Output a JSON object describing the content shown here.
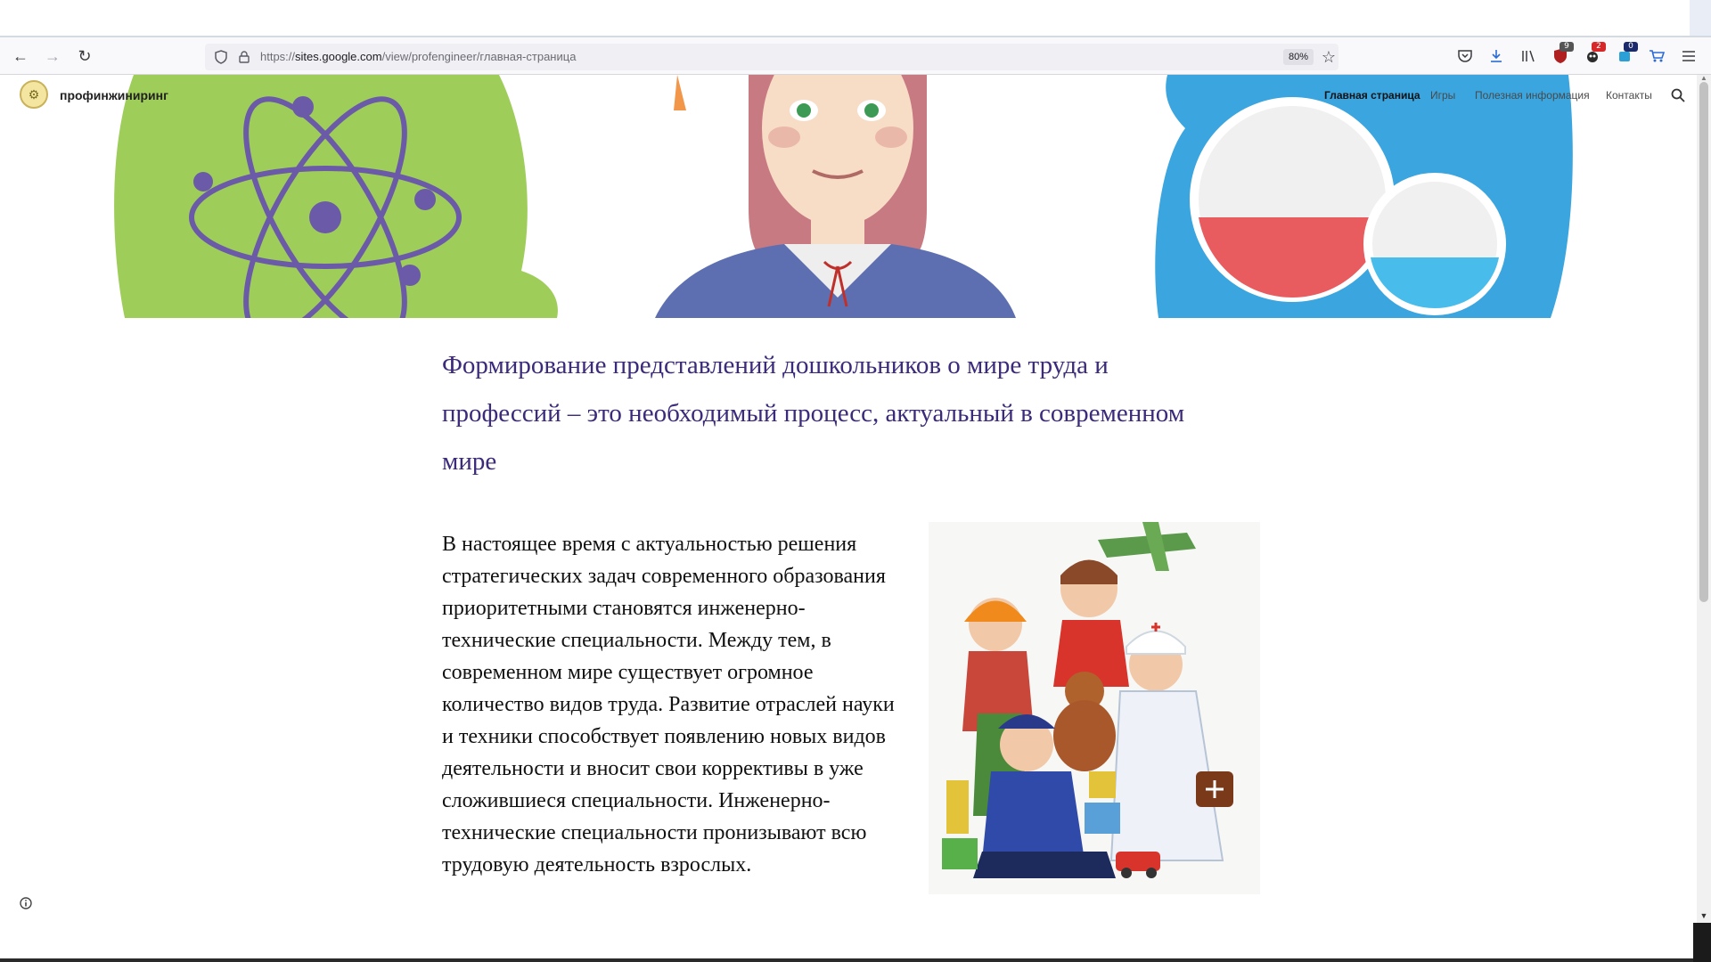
{
  "browser": {
    "url_prefix": "https://",
    "url_domain": "sites.google.com",
    "url_path": "/view/profengineer/главная-страница",
    "zoom": "80%",
    "icons": {
      "back": "arrow-left-icon",
      "forward": "arrow-right-icon",
      "reload": "reload-icon",
      "tracking_protection": "shield-icon",
      "secure": "lock-icon",
      "bookmark": "star-icon",
      "pocket": "pocket-icon",
      "downloads": "download-icon",
      "library": "library-icon",
      "menu": "hamburger-icon"
    },
    "extensions": [
      {
        "name": "ublock-icon",
        "badge": "9",
        "color": "#b02020"
      },
      {
        "name": "extension-red-icon",
        "badge": "2",
        "color": "#d62828"
      },
      {
        "name": "extension-blue-icon",
        "badge": "0",
        "color": "#1b2a6b"
      },
      {
        "name": "cart-icon",
        "badge": "",
        "color": "#2a6bd6"
      }
    ]
  },
  "site": {
    "title": "профинжиниринг",
    "nav": [
      {
        "label": "Главная страница",
        "active": true
      },
      {
        "label": "Игры",
        "active": false
      },
      {
        "label": "Полезная информация",
        "active": false
      },
      {
        "label": "Контакты",
        "active": false
      }
    ]
  },
  "content": {
    "heading": "Формирование представлений дошкольников о мире труда и профессий – это необходимый процесс, актуальный в современном мире",
    "paragraph": "В настоящее время  с актуальностью решения стратегических задач современного образования приоритетными становятся инженерно-технические специальности. Между тем, в современном мире существует огромное количество видов труда.  Развитие отраслей науки и техники способствует появлению новых видов деятельности и вносит свои коррективы в уже сложившиеся специальности. Инженерно-технические специальности пронизывают всю трудовую деятельность взрослых."
  },
  "colors": {
    "heading": "#3c2a7a",
    "hero_green": "#9fcd5a",
    "hero_blue": "#3aa5df",
    "hero_purple": "#6b5aa8"
  }
}
